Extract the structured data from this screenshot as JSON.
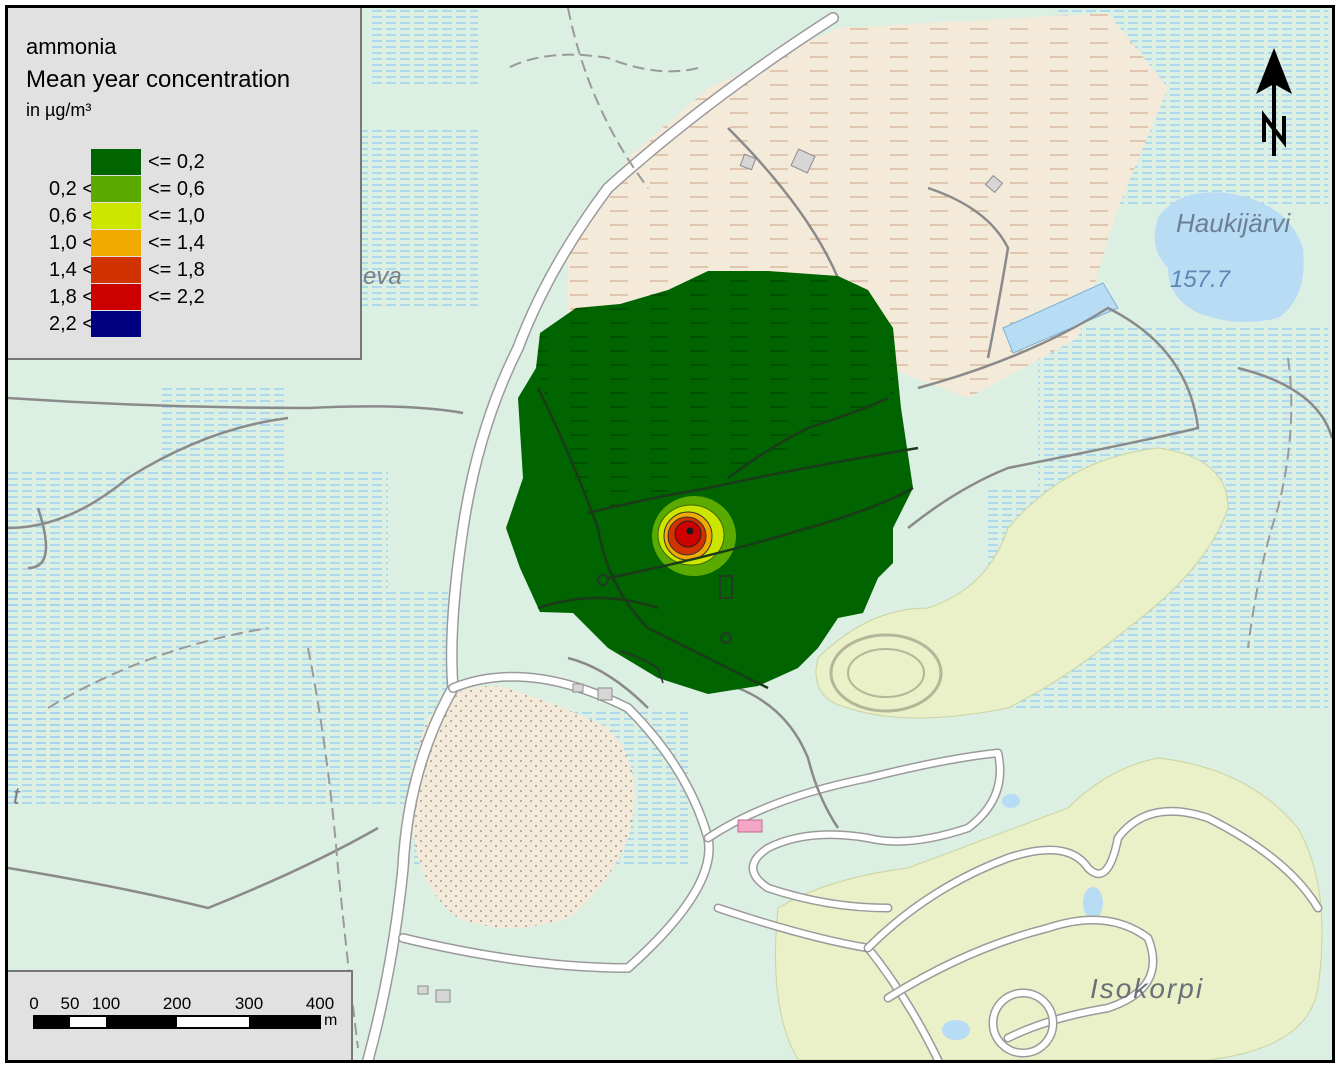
{
  "legend": {
    "pollutant": "ammonia",
    "title": "Mean year concentration",
    "unit": "in µg/m³",
    "classes": [
      {
        "lower": "",
        "upper": "<= 0,2",
        "color": "#006400"
      },
      {
        "lower": "0,2 <",
        "upper": "<= 0,6",
        "color": "#5aaa00"
      },
      {
        "lower": "0,6 <",
        "upper": "<= 1,0",
        "color": "#cce600"
      },
      {
        "lower": "1,0 <",
        "upper": "<= 1,4",
        "color": "#f0aa00"
      },
      {
        "lower": "1,4 <",
        "upper": "<= 1,8",
        "color": "#d23200"
      },
      {
        "lower": "1,8 <",
        "upper": "<= 2,2",
        "color": "#cd0000"
      },
      {
        "lower": "2,2 <",
        "upper": "",
        "color": "#000080"
      }
    ]
  },
  "scale_bar": {
    "ticks": [
      "0",
      "50",
      "100",
      "200",
      "300",
      "400"
    ],
    "unit": "m"
  },
  "north_arrow": {
    "label": "N",
    "icon": "north-arrow-icon"
  },
  "map_labels": {
    "lake_name": "Haukijärvi",
    "lake_elevation": "157.7",
    "place_name": "Isokorpi",
    "left_fragment": "eva",
    "edge_fragment": "t"
  },
  "colors": {
    "terrain": "#dcefe3",
    "water": "#b9dcf5",
    "road": "#ffffff",
    "field": "#eaf0c8",
    "sand": "#f3ead9"
  }
}
